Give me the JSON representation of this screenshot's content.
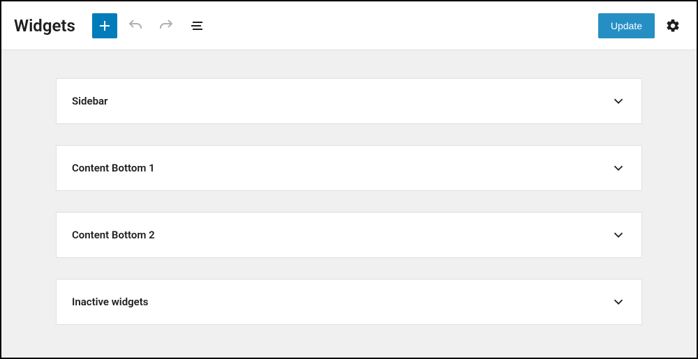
{
  "header": {
    "title": "Widgets",
    "update_label": "Update"
  },
  "areas": [
    {
      "title": "Sidebar"
    },
    {
      "title": "Content Bottom 1"
    },
    {
      "title": "Content Bottom 2"
    },
    {
      "title": "Inactive widgets"
    }
  ]
}
